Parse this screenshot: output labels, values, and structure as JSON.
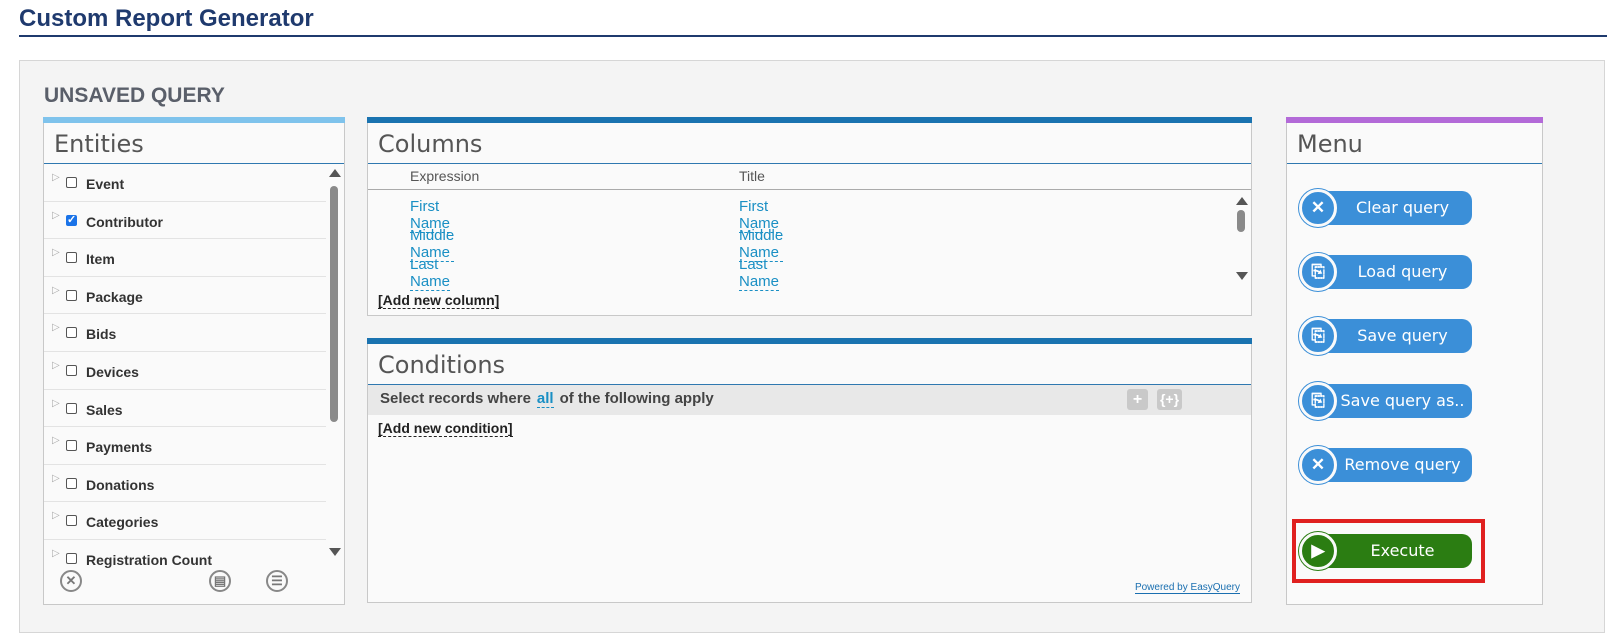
{
  "page": {
    "title": "Custom Report Generator"
  },
  "query": {
    "name": "UNSAVED QUERY"
  },
  "entities": {
    "title": "Entities",
    "items": [
      {
        "label": "Event",
        "checked": false
      },
      {
        "label": "Contributor",
        "checked": true
      },
      {
        "label": "Item",
        "checked": false
      },
      {
        "label": "Package",
        "checked": false
      },
      {
        "label": "Bids",
        "checked": false
      },
      {
        "label": "Devices",
        "checked": false
      },
      {
        "label": "Sales",
        "checked": false
      },
      {
        "label": "Payments",
        "checked": false
      },
      {
        "label": "Donations",
        "checked": false
      },
      {
        "label": "Categories",
        "checked": false
      },
      {
        "label": "Registration Count",
        "checked": false
      }
    ],
    "tools": [
      "clear-icon",
      "table-icon",
      "list-icon"
    ]
  },
  "columns": {
    "title": "Columns",
    "headers": {
      "expression": "Expression",
      "title": "Title"
    },
    "rows": [
      {
        "expression": "First Name",
        "title": "First Name"
      },
      {
        "expression": "Middle Name",
        "title": "Middle Name"
      },
      {
        "expression": "Last Name",
        "title": "Last Name"
      }
    ],
    "add_label": "[Add new column]"
  },
  "conditions": {
    "title": "Conditions",
    "prefix": "Select records where",
    "link": "all",
    "suffix": "of the following apply",
    "add_condition_icon": "+",
    "add_group_icon": "{+}",
    "add_label": "[Add new condition]",
    "powered": "Powered by EasyQuery"
  },
  "menu": {
    "title": "Menu",
    "buttons": [
      {
        "label": "Clear query",
        "icon": "close-icon"
      },
      {
        "label": "Load query",
        "icon": "file-icon"
      },
      {
        "label": "Save query",
        "icon": "file-icon"
      },
      {
        "label": "Save query as..",
        "icon": "file-icon"
      },
      {
        "label": "Remove query",
        "icon": "close-icon"
      }
    ],
    "execute": {
      "label": "Execute",
      "icon": "play-icon"
    },
    "colors": {
      "button": "#3b8fd8",
      "execute": "#2b7d12",
      "highlight": "#e0201f"
    }
  }
}
